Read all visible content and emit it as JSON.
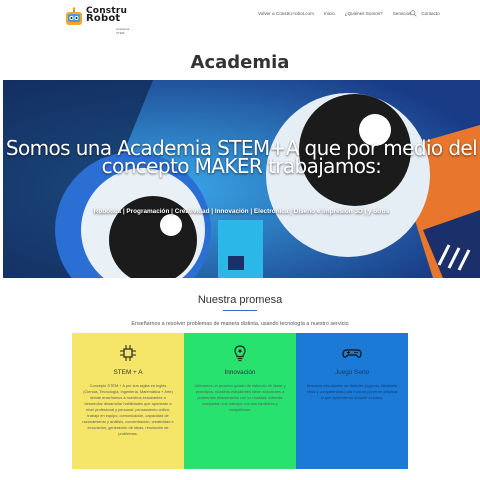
{
  "logo": {
    "line1": "Constru",
    "line2": "Robot",
    "tag": "Academia STEM"
  },
  "nav": {
    "items": [
      "Volver a Constru-robot.com",
      "Inicio",
      "¿Quiénes Somos?",
      "Servicios",
      "Contacto"
    ]
  },
  "page_title": "Academia",
  "hero": {
    "heading": "Somos una Academia STEM+A que por medio del concepto MAKER trabajamos:",
    "subtitle": "Robótica | Programación | Creatividad | Innovación | Electrónica | Diseño e Impresión 3D | y otros"
  },
  "promesa": {
    "title": "Nuestra promesa",
    "description": "Enseñarnos a resolver problemas de manera distinta, usando tecnología a nuestro servicio"
  },
  "cards": [
    {
      "title": "STEM + A",
      "icon": "circuit-chip-icon",
      "text": "Concepto STEM + A por sus siglas en inglés (Ciencia, Tecnología, Ingeniería, Matemática + Arte) donde enseñamos a nuestros estudiantes a desarrollar desarrollar habilidades que aportarán a nivel profesional y personal: pensamiento crítico, trabajo en equipo, comunicación, capacidad de razonamiento y análisis, concentración, creatividad e innovación, generación de ideas, resolución de problemas."
    },
    {
      "title": "Innovación",
      "icon": "lightbulb-icon",
      "text": "Utilizamos un proceso guiado de estímulo de ideas y prototipos, nuestros estudiantes idean soluciones a problemas relacionados con su realidad. Además compartan sus trabajos con sus familiares y compañeros."
    },
    {
      "title": "Juego Serio",
      "icon": "gamepad-icon",
      "text": "Nuestros estudiantes se divierten jugando. Mediante retos y competencias para motivar poner en práctica lo que aprendieron durante el curso."
    }
  ]
}
